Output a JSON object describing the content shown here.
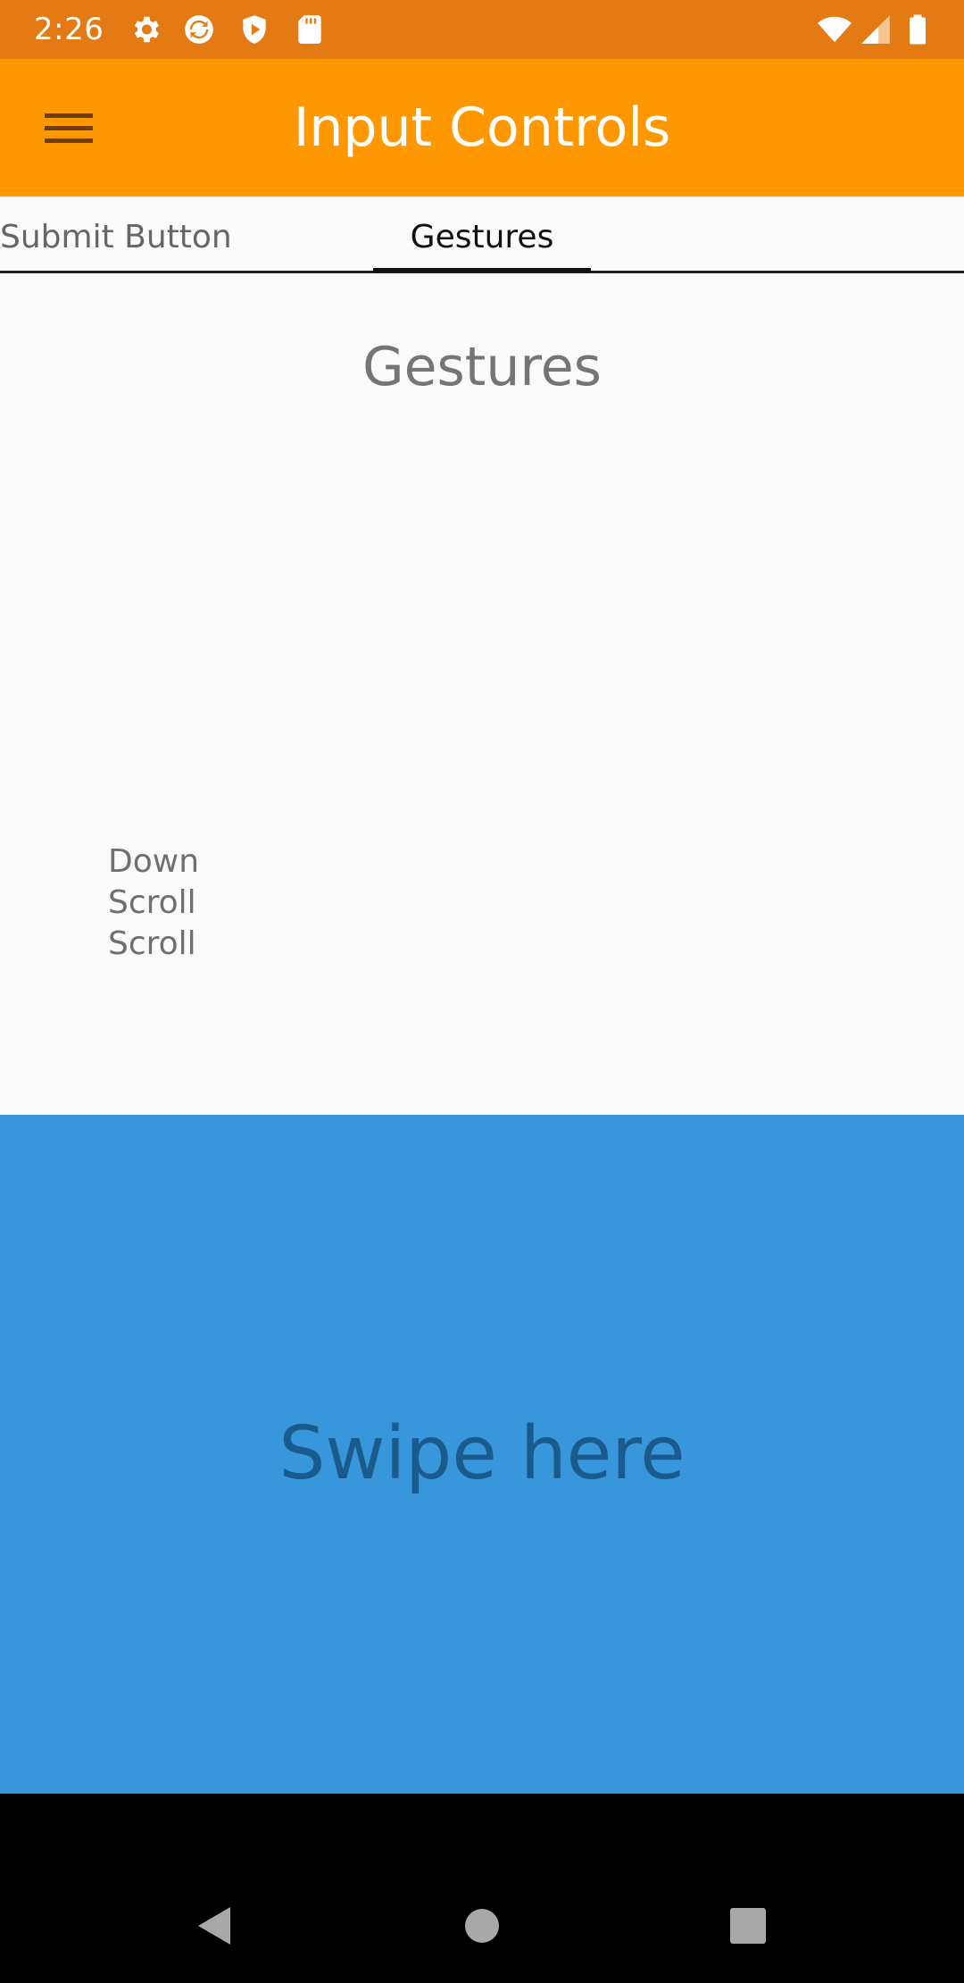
{
  "status_bar": {
    "time": "2:26",
    "icons_left": [
      "settings-icon",
      "sync-icon",
      "shield-play-icon",
      "sd-card-icon"
    ],
    "icons_right": [
      "wifi-icon",
      "signal-icon",
      "battery-icon"
    ]
  },
  "toolbar": {
    "title": "Input Controls",
    "menu_icon": "hamburger-menu-icon"
  },
  "tabs": [
    {
      "label": "Submit Button",
      "selected": false
    },
    {
      "label": "Gestures",
      "selected": true
    }
  ],
  "content": {
    "heading": "Gestures",
    "event_log": [
      "Down",
      "Scroll",
      "Scroll"
    ]
  },
  "swipe_area": {
    "label": "Swipe here",
    "color": "#3897db"
  },
  "nav_bar": {
    "buttons": [
      "back-icon",
      "home-icon",
      "recents-icon"
    ]
  },
  "colors": {
    "status_bar": "#e37a14",
    "toolbar": "#ff9800",
    "swipe_area": "#3897db",
    "swipe_text": "#1b5a8c"
  }
}
